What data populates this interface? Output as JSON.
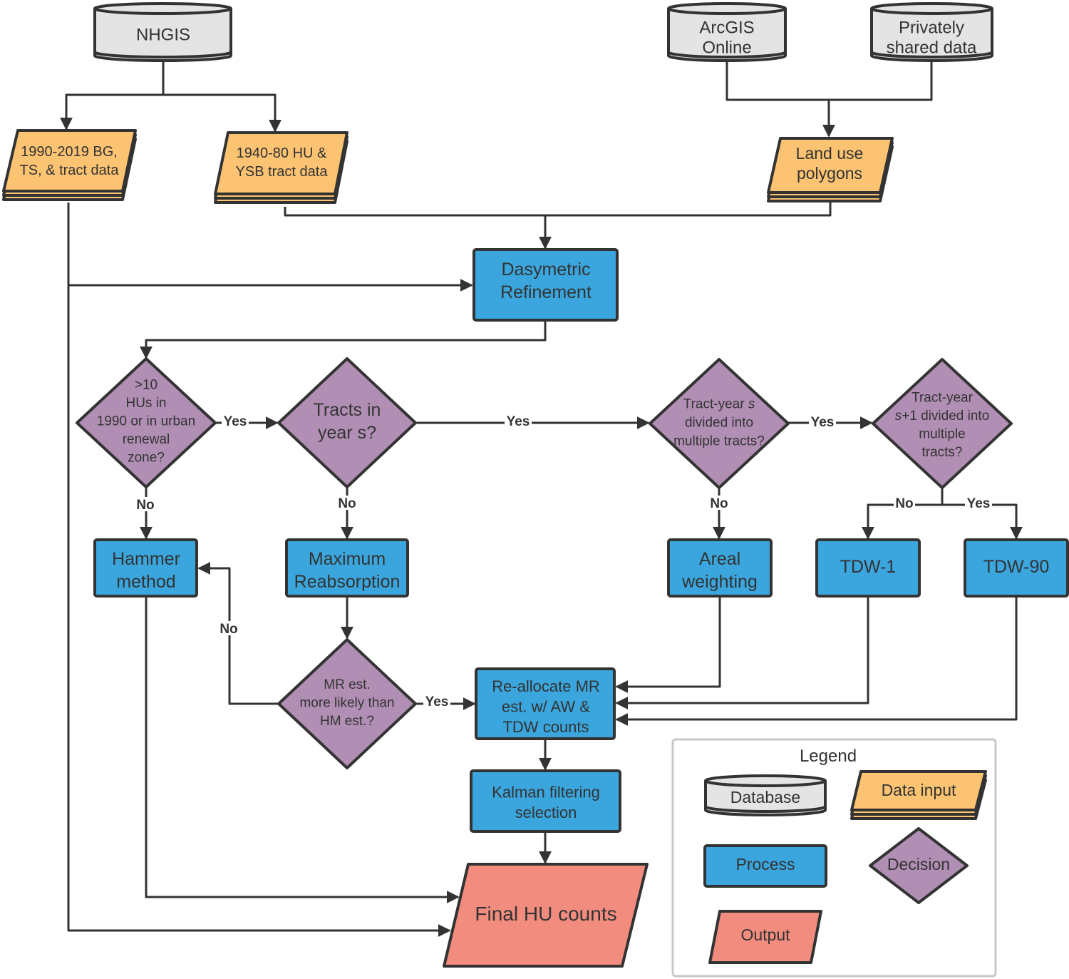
{
  "colors": {
    "database": "#e4e4e4",
    "data_input": "#fbc372",
    "process": "#3aa6dd",
    "decision": "#b18fb4",
    "output": "#f28c7e",
    "stroke": "#333333"
  },
  "nodes": {
    "nhgis": [
      "NHGIS"
    ],
    "arcgis": [
      "ArcGIS",
      "Online"
    ],
    "private": [
      "Privately",
      "shared data"
    ],
    "bg_data": [
      "1990-2019 BG,",
      "TS, & tract data"
    ],
    "hu_data": [
      "1940-80 HU &",
      "YSB tract data"
    ],
    "land_use": [
      "Land use",
      "polygons"
    ],
    "dasymetric": [
      "Dasymetric",
      "Refinement"
    ],
    "d1": [
      ">10",
      "HUs in",
      "1990 or in urban",
      "renewal",
      "zone?"
    ],
    "d2": [
      "Tracts in",
      "year s?"
    ],
    "d3": [
      "Tract-year s",
      "divided into",
      "multiple tracts?"
    ],
    "d4": [
      "Tract-year",
      "s+1 divided into",
      "multiple",
      "tracts?"
    ],
    "hammer": [
      "Hammer",
      "method"
    ],
    "maxr": [
      "Maximum",
      "Reabsorption"
    ],
    "areal": [
      "Areal",
      "weighting"
    ],
    "tdw1": [
      "TDW-1"
    ],
    "tdw90": [
      "TDW-90"
    ],
    "d5": [
      "MR est.",
      "more likely than",
      "HM est.?"
    ],
    "realloc": [
      "Re-allocate MR",
      "est. w/ AW &",
      "TDW counts"
    ],
    "kalman": [
      "Kalman filtering",
      "selection"
    ],
    "final": [
      "Final HU counts"
    ]
  },
  "edge_labels": {
    "yes": "Yes",
    "no": "No"
  },
  "legend": {
    "title": "Legend",
    "database": "Database",
    "data_input": "Data input",
    "process": "Process",
    "decision": "Decision",
    "output": "Output"
  }
}
